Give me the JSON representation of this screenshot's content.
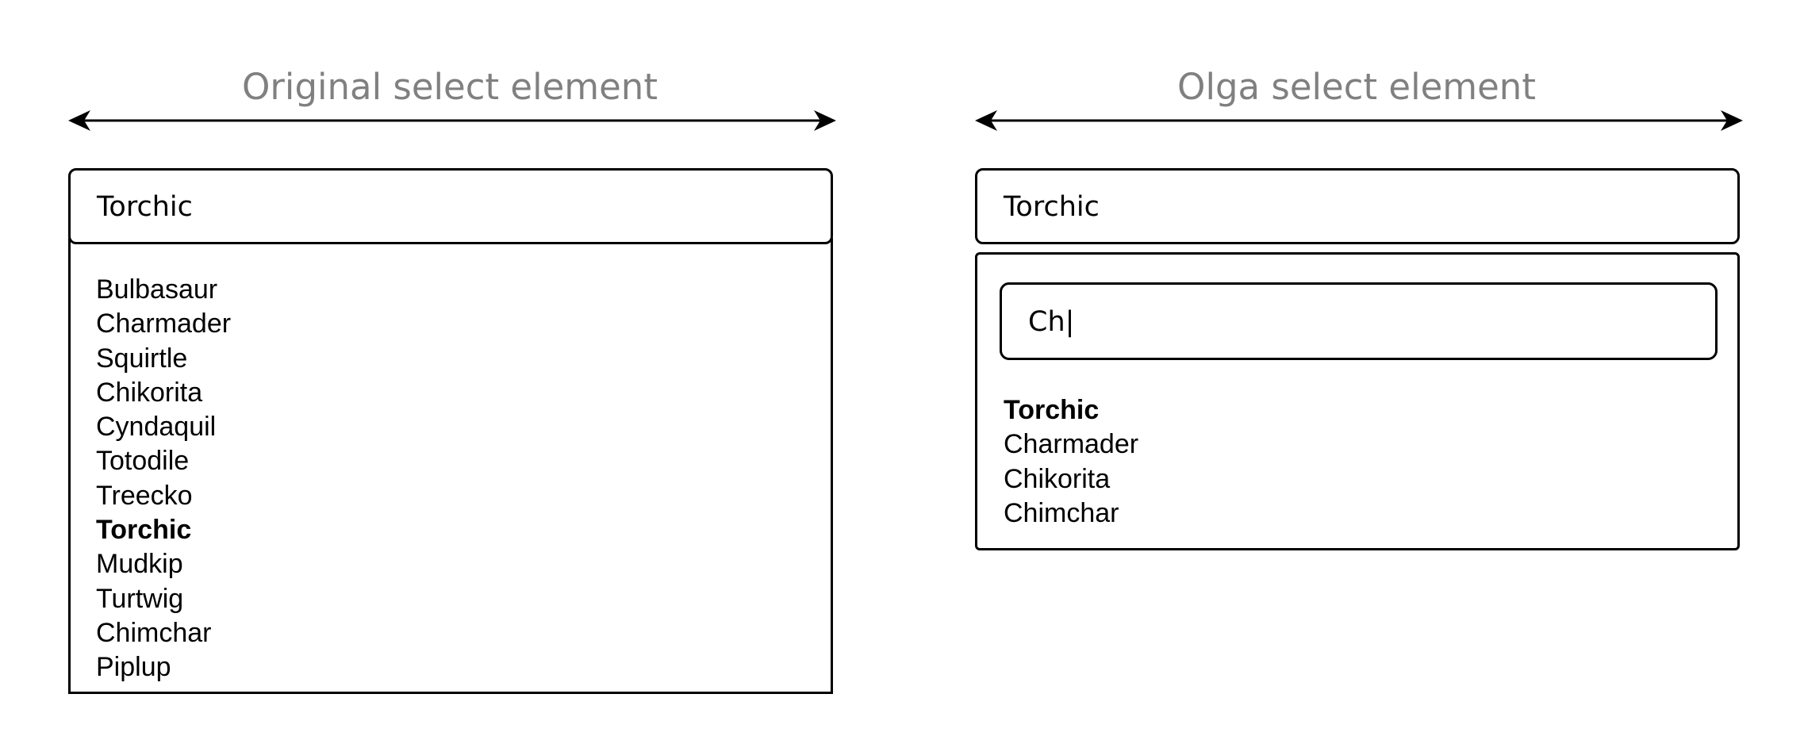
{
  "left_panel": {
    "title": "Original select element",
    "selected_value": "Torchic",
    "options": [
      {
        "label": "Bulbasaur",
        "selected": false
      },
      {
        "label": "Charmader",
        "selected": false
      },
      {
        "label": "Squirtle",
        "selected": false
      },
      {
        "label": "Chikorita",
        "selected": false
      },
      {
        "label": "Cyndaquil",
        "selected": false
      },
      {
        "label": "Totodile",
        "selected": false
      },
      {
        "label": "Treecko",
        "selected": false
      },
      {
        "label": "Torchic",
        "selected": true
      },
      {
        "label": "Mudkip",
        "selected": false
      },
      {
        "label": "Turtwig",
        "selected": false
      },
      {
        "label": "Chimchar",
        "selected": false
      },
      {
        "label": "Piplup",
        "selected": false
      }
    ]
  },
  "right_panel": {
    "title": "Olga select element",
    "selected_value": "Torchic",
    "search_text": "Ch|",
    "options": [
      {
        "label": "Torchic",
        "selected": true
      },
      {
        "label": "Charmader",
        "selected": false
      },
      {
        "label": "Chikorita",
        "selected": false
      },
      {
        "label": "Chimchar",
        "selected": false
      }
    ]
  },
  "colors": {
    "title": "#808080",
    "line": "#000000",
    "background": "#ffffff"
  }
}
